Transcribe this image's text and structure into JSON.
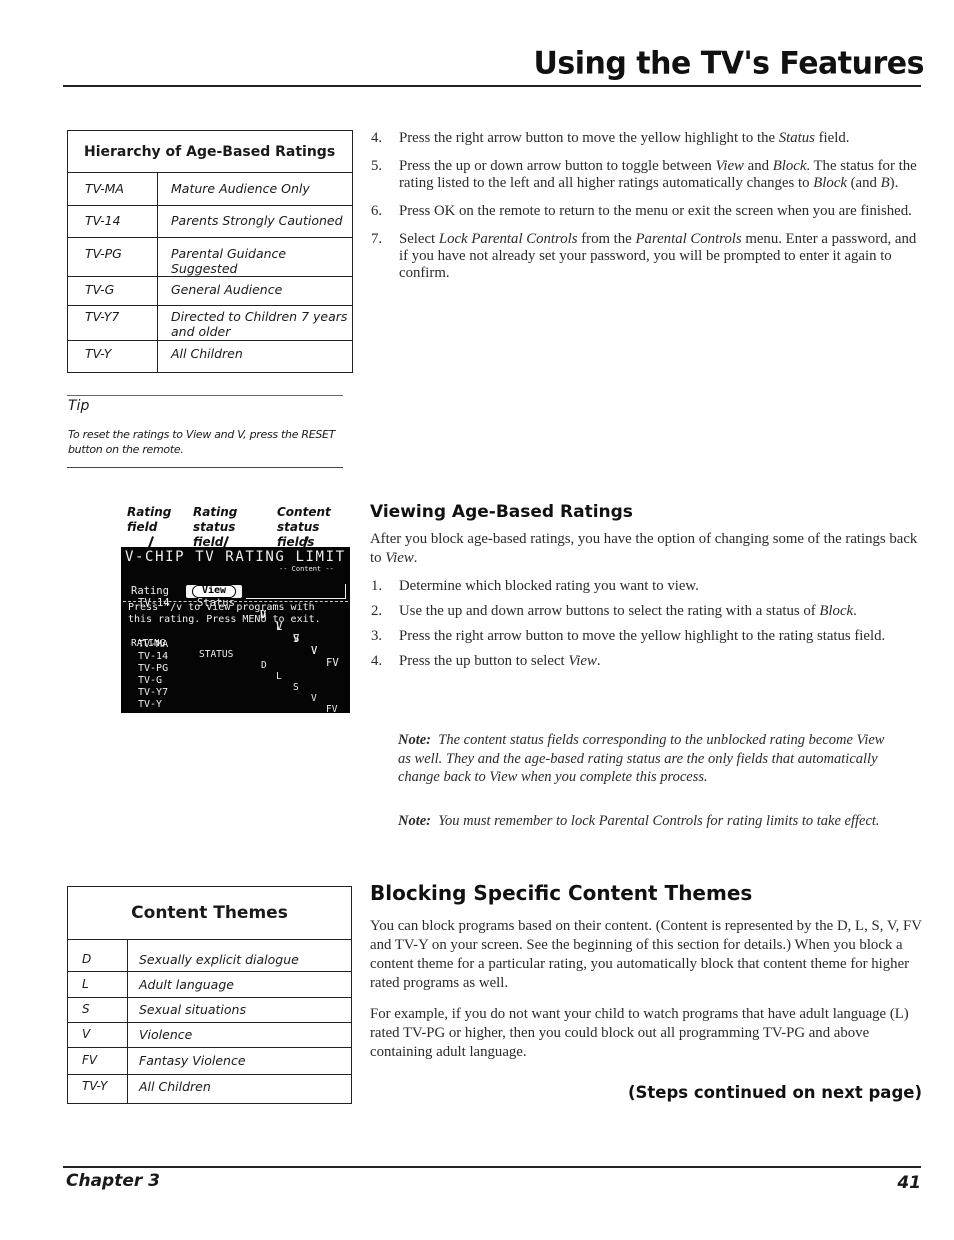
{
  "header": {
    "title": "Using the TV's Features"
  },
  "ratings_table": {
    "title": "Hierarchy of Age-Based Ratings",
    "rows": [
      {
        "code": "TV-MA",
        "description": "Mature Audience Only"
      },
      {
        "code": "TV-14",
        "description": "Parents Strongly Cautioned"
      },
      {
        "code": "TV-PG",
        "description": "Parental Guidance Suggested"
      },
      {
        "code": "TV-G",
        "description": "General Audience"
      },
      {
        "code": "TV-Y7",
        "description": "Directed to Children 7 years and older"
      },
      {
        "code": "TV-Y",
        "description": "All Children"
      }
    ]
  },
  "tip": {
    "label": "Tip",
    "text": "To reset the ratings to View and V, press the RESET button on the remote."
  },
  "steps_top": [
    {
      "num": "4.",
      "parts": [
        "Press the right arrow button to move the yellow highlight to the ",
        {
          "i": "Status"
        },
        " field."
      ]
    },
    {
      "num": "5.",
      "parts": [
        "Press the up or down arrow button to toggle between ",
        {
          "i": "View"
        },
        " and ",
        {
          "i": "Block"
        },
        ". The status for the rating listed to the left and all higher ratings automatically changes to ",
        {
          "i": "Block"
        },
        " (and ",
        {
          "i": "B"
        },
        ")."
      ]
    },
    {
      "num": "6.",
      "parts": [
        "Press OK on the remote to return to the menu or exit the screen when you are finished."
      ]
    },
    {
      "num": "7.",
      "parts": [
        "Select ",
        {
          "i": "Lock Parental Controls"
        },
        " from the ",
        {
          "i": "Parental Controls"
        },
        " menu. Enter a password, and if you have not already set your password, you will be prompted to enter it again to confirm."
      ]
    }
  ],
  "tv_screen": {
    "callouts": {
      "rating_field": "Rating field",
      "rating_status_field": "Rating status field",
      "content_status_fields": "Content status fields"
    },
    "title": "V-CHIP TV RATING LIMIT",
    "content_label": "-- Content --",
    "header": {
      "rating": "Rating",
      "status": "Status",
      "cols": [
        "D",
        "L",
        "S",
        "V",
        "FV"
      ]
    },
    "current": {
      "rating": "TV-14",
      "status": "View",
      "values": [
        "V",
        "V",
        "V",
        "V",
        ""
      ]
    },
    "message_line1": "Press ^/v to view programs with",
    "message_line2": "this rating. Press MENU to exit.",
    "list_header": {
      "rating": "RATING",
      "status": "STATUS",
      "cols": [
        "D",
        "L",
        "S",
        "V",
        "FV"
      ]
    },
    "list": [
      "TV-MA",
      "TV-14",
      "TV-PG",
      "TV-G",
      "TV-Y7",
      "TV-Y"
    ]
  },
  "viewing": {
    "heading": "Viewing Age-Based Ratings",
    "intro_parts": [
      "After you block age-based ratings, you have the option of changing some of the ratings back to ",
      {
        "i": "View"
      },
      "."
    ],
    "steps": [
      {
        "num": "1.",
        "parts": [
          "Determine which blocked rating you want to view."
        ]
      },
      {
        "num": "2.",
        "parts": [
          "Use the up and down arrow buttons to select the rating with a status of ",
          {
            "i": "Block"
          },
          "."
        ]
      },
      {
        "num": "3.",
        "parts": [
          "Press the right arrow button to move the yellow highlight to the rating status field."
        ]
      },
      {
        "num": "4.",
        "parts": [
          "Press the up button to select ",
          {
            "i": "View"
          },
          "."
        ]
      }
    ],
    "notes": [
      {
        "label": "Note:",
        "text": "The content status fields corresponding to the unblocked rating become View as well. They and the age-based rating status are the only fields that automatically change back to View when you complete this process."
      },
      {
        "label": "Note:",
        "text": "You must remember to lock Parental Controls for rating limits to take effect."
      }
    ]
  },
  "themes_table": {
    "title": "Content Themes",
    "rows": [
      {
        "code": "D",
        "description": "Sexually explicit dialogue"
      },
      {
        "code": "L",
        "description": "Adult language"
      },
      {
        "code": "S",
        "description": "Sexual situations"
      },
      {
        "code": "V",
        "description": "Violence"
      },
      {
        "code": "FV",
        "description": "Fantasy Violence"
      },
      {
        "code": "TV-Y",
        "description": "All Children"
      }
    ]
  },
  "blocking": {
    "heading": "Blocking Specific Content Themes",
    "paragraph1": "You can block programs based on their content. (Content is represented by the D, L, S, V, FV and TV-Y on your screen. See the beginning of this section for details.) When you block a content theme for a particular rating, you automatically block that content theme for higher rated programs as well.",
    "paragraph2": "For example, if you do not want your child to watch programs that have adult language (L) rated TV-PG or higher, then you could block out all programming TV-PG and above containing adult language.",
    "continued": "(Steps continued on next page)"
  },
  "footer": {
    "chapter": "Chapter 3",
    "page": "41"
  }
}
